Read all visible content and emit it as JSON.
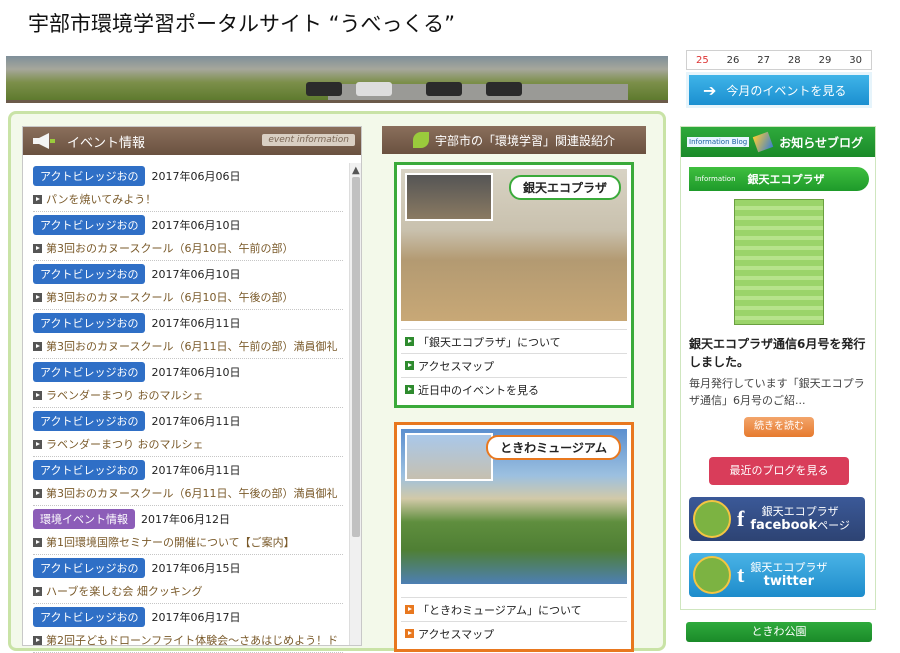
{
  "page": {
    "title": "宇部市環境学習ポータルサイト “うべっくる”"
  },
  "calendar": {
    "days": [
      "25",
      "26",
      "27",
      "28",
      "29",
      "30"
    ]
  },
  "month_event_button": "今月のイベントを見る",
  "event_panel": {
    "title": "イベント情報",
    "subtitle": "event information",
    "items": [
      {
        "category": "アクトビレッジおの",
        "category_color": "#2f6fc6",
        "date": "2017年06月06日",
        "title": "パンを焼いてみよう！"
      },
      {
        "category": "アクトビレッジおの",
        "category_color": "#2f6fc6",
        "date": "2017年06月10日",
        "title": "第3回おのカヌースクール（6月10日、午前の部）"
      },
      {
        "category": "アクトビレッジおの",
        "category_color": "#2f6fc6",
        "date": "2017年06月10日",
        "title": "第3回おのカヌースクール（6月10日、午後の部）"
      },
      {
        "category": "アクトビレッジおの",
        "category_color": "#2f6fc6",
        "date": "2017年06月11日",
        "title": "第3回おのカヌースクール（6月11日、午前の部）満員御礼"
      },
      {
        "category": "アクトビレッジおの",
        "category_color": "#2f6fc6",
        "date": "2017年06月10日",
        "title": "ラベンダーまつり おのマルシェ"
      },
      {
        "category": "アクトビレッジおの",
        "category_color": "#2f6fc6",
        "date": "2017年06月11日",
        "title": "ラベンダーまつり おのマルシェ"
      },
      {
        "category": "アクトビレッジおの",
        "category_color": "#2f6fc6",
        "date": "2017年06月11日",
        "title": "第3回おのカヌースクール（6月11日、午後の部）満員御礼"
      },
      {
        "category": "環境イベント情報",
        "category_color": "#8c5db8",
        "date": "2017年06月12日",
        "title": "第1回環境国際セミナーの開催について【ご案内】"
      },
      {
        "category": "アクトビレッジおの",
        "category_color": "#2f6fc6",
        "date": "2017年06月15日",
        "title": "ハーブを楽しむ会 畑クッキング"
      },
      {
        "category": "アクトビレッジおの",
        "category_color": "#2f6fc6",
        "date": "2017年06月17日",
        "title": "第2回子どもドローンフライト体験会～さあはじめよう！ド"
      }
    ]
  },
  "facilities": {
    "title": "宇部市の「環境学習」関連設紹介",
    "cards": [
      {
        "name": "銀天エコプラザ",
        "links": [
          "「銀天エコプラザ」について",
          "アクセスマップ",
          "近日中のイベントを見る"
        ]
      },
      {
        "name": "ときわミュージアム",
        "links": [
          "「ときわミュージアム」について",
          "アクセスマップ"
        ]
      }
    ]
  },
  "blog": {
    "header_badge": "Information Blog",
    "title": "お知らせブログ",
    "tag_small": "Information",
    "tag": "銀天エコプラザ",
    "post_title": "銀天エコプラザ通信6月号を発行しました。",
    "excerpt": "毎月発行しています「銀天エコプラザ通信」6月号のご紹...",
    "more": "続きを読む",
    "recent": "最近のブログを見る",
    "facebook": {
      "line1": "銀天エコプラザ",
      "brand": "facebook",
      "suffix": "ページ",
      "glyph": "f"
    },
    "twitter": {
      "line1": "銀天エコプラザ",
      "brand": "twitter",
      "glyph": "t"
    },
    "next_tab": "ときわ公園"
  }
}
